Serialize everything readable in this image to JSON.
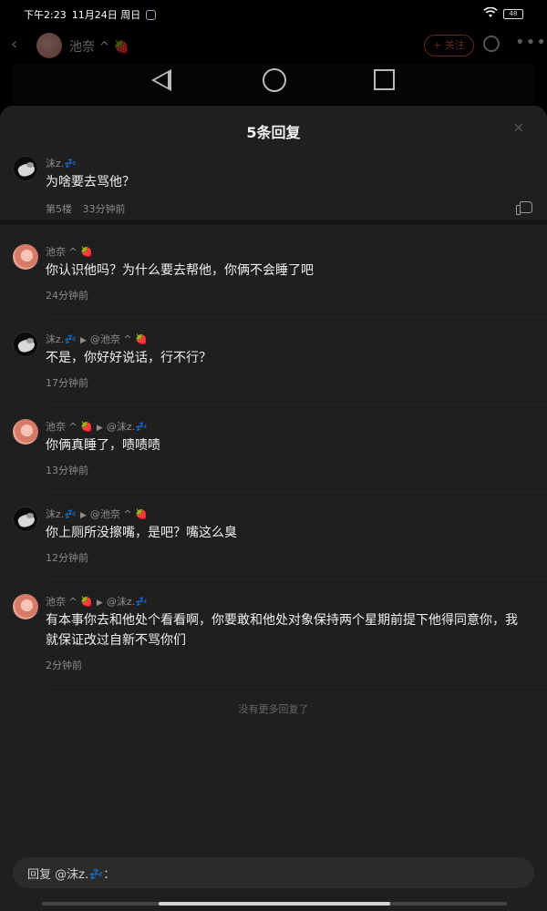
{
  "status_bar": {
    "time": "下午2:23",
    "date": "11月24日 周日",
    "battery": "48"
  },
  "post_header": {
    "author": "池奈 ^ 🍓",
    "follow_label": "+ 关注"
  },
  "sheet": {
    "title": "5条回复",
    "close_label": "×"
  },
  "original": {
    "author": "沫z.💤",
    "text": "为啥要去骂他？",
    "floor": "第5楼",
    "time": "33分钟前"
  },
  "replies": [
    {
      "author": "池奈 ^ 🍓",
      "reply_to": "",
      "text": "你认识他吗？为什么要去帮他，你俩不会睡了吧",
      "time": "24分钟前"
    },
    {
      "author": "沫z.💤",
      "reply_to": "@池奈 ^ 🍓",
      "text": "不是，你好好说话，行不行？",
      "time": "17分钟前"
    },
    {
      "author": "池奈 ^ 🍓",
      "reply_to": "@沫z.💤",
      "text": "你俩真睡了，啧啧啧",
      "time": "13分钟前"
    },
    {
      "author": "沫z.💤",
      "reply_to": "@池奈 ^ 🍓",
      "text": "你上厕所没擦嘴，是吧？嘴这么臭",
      "time": "12分钟前"
    },
    {
      "author": "池奈 ^ 🍓",
      "reply_to": "@沫z.💤",
      "text": "有本事你去和他处个看看啊，你要敢和他处对象保持两个星期前提下他得同意你，我就保证改过自新不骂你们",
      "time": "2分钟前"
    }
  ],
  "no_more_text": "没有更多回复了",
  "reply_input": {
    "placeholder": "回复 @沫z.💤："
  }
}
